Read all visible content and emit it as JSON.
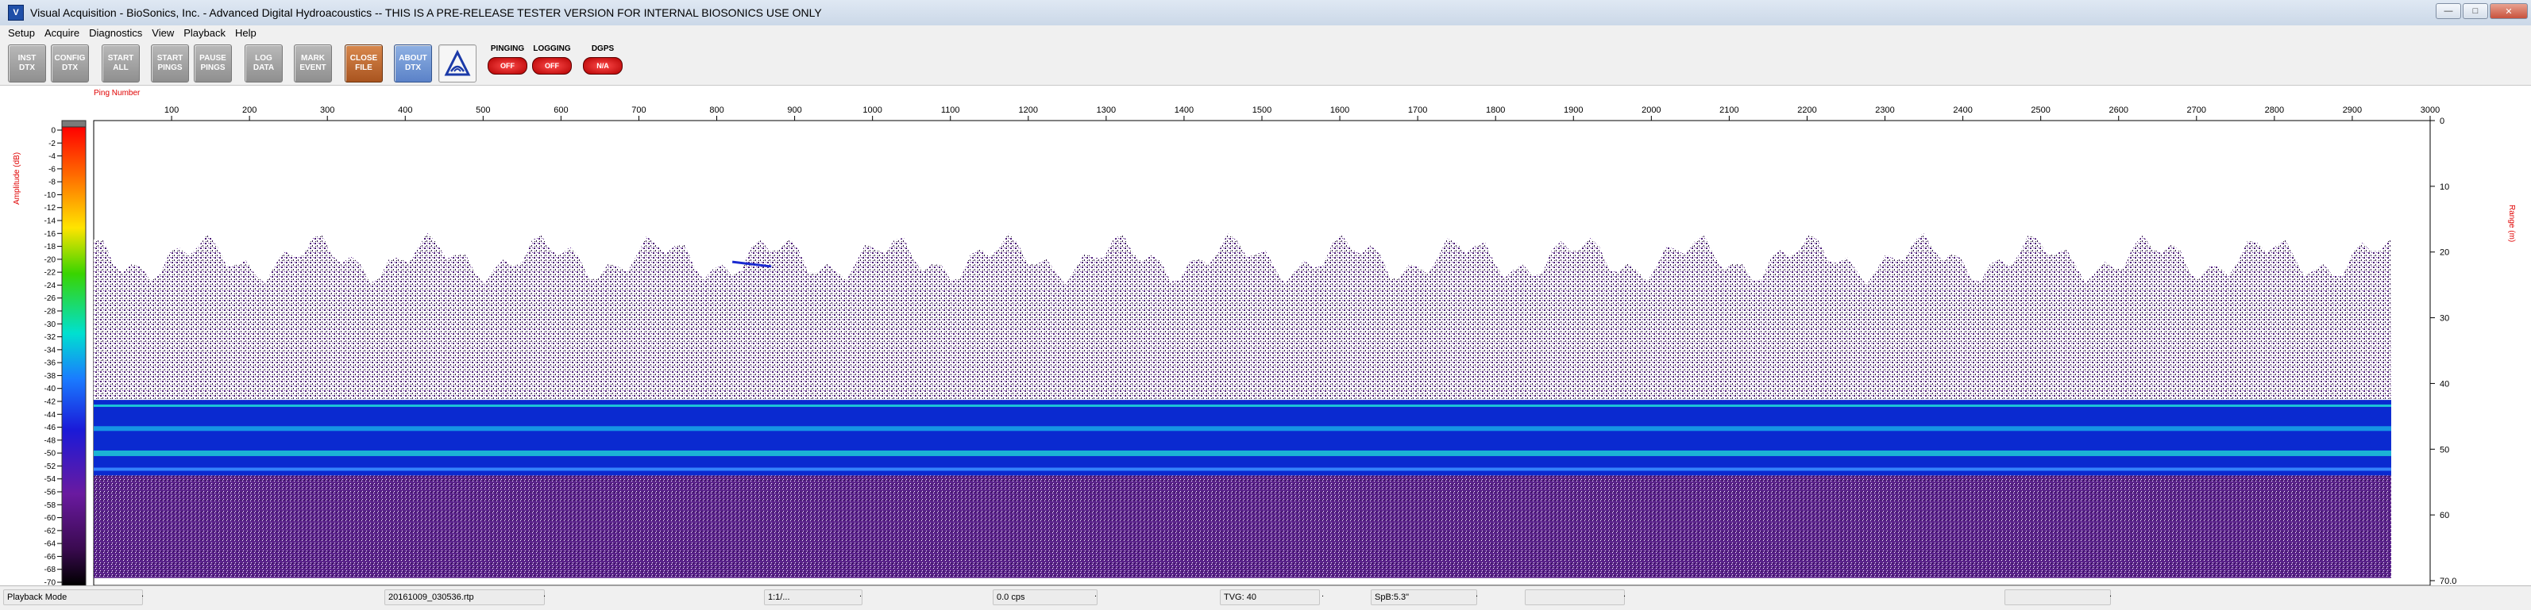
{
  "window": {
    "title": "Visual Acquisition  -  BioSonics, Inc.  -  Advanced Digital Hydroacoustics  -- THIS IS A PRE-RELEASE TESTER VERSION FOR INTERNAL BIOSONICS USE ONLY",
    "icon": "app-logo-icon",
    "controls": [
      "minimize",
      "maximize",
      "close"
    ]
  },
  "menu": [
    "Setup",
    "Acquire",
    "Diagnostics",
    "View",
    "Playback",
    "Help"
  ],
  "toolbar": {
    "buttons": [
      {
        "label": "INST\nDTX",
        "style": "gray"
      },
      {
        "label": "CONFIG\nDTX",
        "style": "gray"
      },
      {
        "label": "START\nALL",
        "style": "gray"
      },
      {
        "label": "START\nPINGS",
        "style": "gray"
      },
      {
        "label": "PAUSE\nPINGS",
        "style": "gray"
      },
      {
        "label": "LOG\nDATA",
        "style": "gray"
      },
      {
        "label": "MARK\nEVENT",
        "style": "gray"
      },
      {
        "label": "CLOSE\nFILE",
        "style": "orange"
      },
      {
        "label": "ABOUT\nDTX",
        "style": "blue"
      }
    ],
    "logo_icon": "biosonics-logo-icon",
    "indicators": [
      {
        "label": "PINGING",
        "value": "OFF"
      },
      {
        "label": "LOGGING",
        "value": "OFF"
      },
      {
        "label": "DGPS",
        "value": "N/A"
      }
    ]
  },
  "echogram": {
    "ping_axis_label": "Ping Number",
    "ping_ticks": [
      "100",
      "200",
      "300",
      "400",
      "500",
      "600",
      "700",
      "800",
      "900",
      "1000",
      "1100",
      "1200",
      "1300",
      "1400",
      "1500",
      "1600",
      "1700",
      "1800",
      "1900",
      "2000",
      "2100",
      "2200",
      "2300",
      "2400",
      "2500",
      "2600",
      "2700",
      "2800",
      "2900",
      "3000"
    ],
    "amplitude_label": "Amplitude (dB)",
    "amplitude_ticks": [
      "0",
      "-2",
      "-4",
      "-6",
      "-8",
      "-10",
      "-12",
      "-14",
      "-16",
      "-18",
      "-20",
      "-22",
      "-24",
      "-26",
      "-28",
      "-30",
      "-32",
      "-34",
      "-36",
      "-38",
      "-40",
      "-42",
      "-44",
      "-46",
      "-48",
      "-50",
      "-52",
      "-54",
      "-56",
      "-58",
      "-60",
      "-62",
      "-64",
      "-66",
      "-68",
      "-70"
    ],
    "range_label": "Range (m)",
    "range_ticks": [
      "0",
      "10",
      "20",
      "30",
      "40",
      "50",
      "60",
      "70.0"
    ],
    "max_ping": 2950,
    "max_range": 70,
    "colors": {
      "scatter": "#4b1a78",
      "band_core": "#0a2ad0",
      "band_high": "#1fd6d6"
    }
  },
  "statusbar": {
    "mode": "Playback Mode",
    "file": "20161009_030536.rtp",
    "ratio": "1:1/...",
    "rate": "0.0 cps",
    "tvg": "TVG: 40",
    "spb": "SpB:5.3\""
  }
}
